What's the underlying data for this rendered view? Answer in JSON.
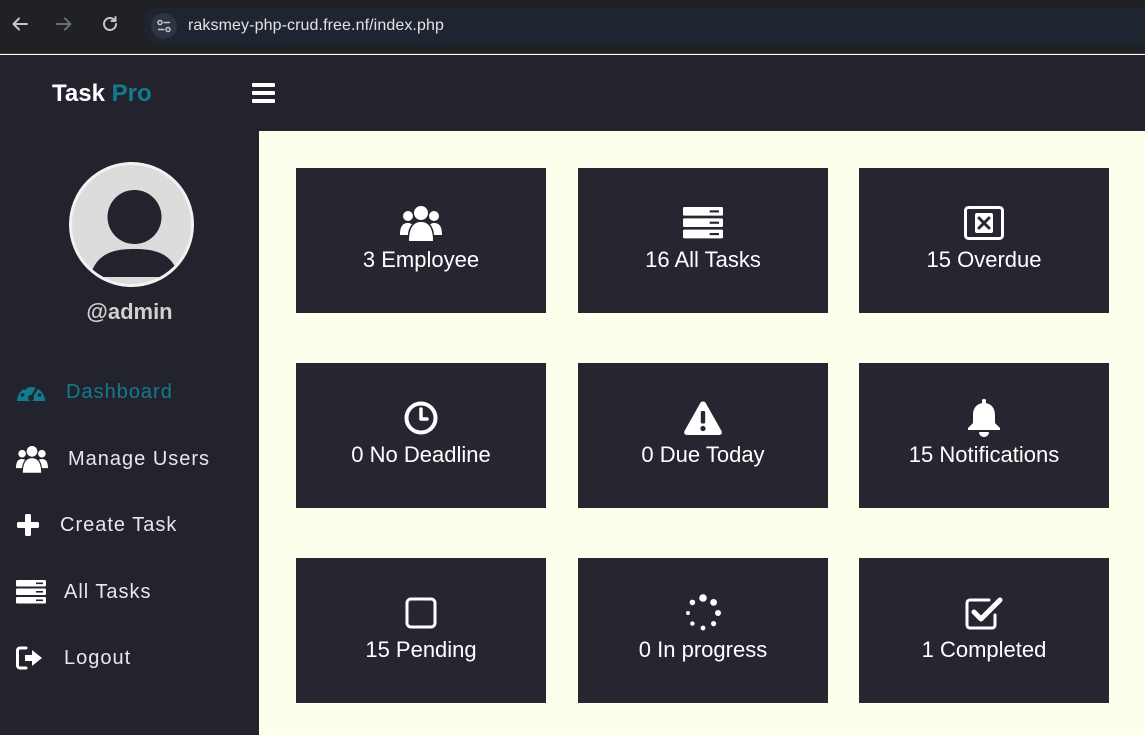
{
  "browser": {
    "url": "raksmey-php-crud.free.nf/index.php",
    "back_icon": "arrow-left-icon",
    "forward_icon": "arrow-right-icon",
    "reload_icon": "reload-icon",
    "site_info_icon": "site-settings-icon"
  },
  "header": {
    "brand_main": "Task",
    "brand_accent": "Pro",
    "menu_icon": "hamburger-menu-icon"
  },
  "sidebar": {
    "avatar_icon": "user-avatar-icon",
    "username": "@admin",
    "items": [
      {
        "label": "Dashboard",
        "icon": "dashboard-gauge-icon",
        "active": true
      },
      {
        "label": "Manage Users",
        "icon": "users-icon",
        "active": false
      },
      {
        "label": "Create Task",
        "icon": "plus-icon",
        "active": false
      },
      {
        "label": "All Tasks",
        "icon": "task-list-icon",
        "active": false
      },
      {
        "label": "Logout",
        "icon": "logout-icon",
        "active": false
      }
    ]
  },
  "cards": [
    {
      "text": "3 Employee",
      "icon": "users-icon"
    },
    {
      "text": "16 All Tasks",
      "icon": "task-list-icon"
    },
    {
      "text": "15 Overdue",
      "icon": "x-square-icon"
    },
    {
      "text": "0 No Deadline",
      "icon": "clock-icon"
    },
    {
      "text": "0 Due Today",
      "icon": "warning-icon"
    },
    {
      "text": "15 Notifications",
      "icon": "bell-icon"
    },
    {
      "text": "15 Pending",
      "icon": "square-icon"
    },
    {
      "text": "0 In progress",
      "icon": "spinner-icon"
    },
    {
      "text": "1 Completed",
      "icon": "check-square-icon"
    }
  ],
  "colors": {
    "accent": "#127b8e",
    "panel": "#23232d",
    "card": "#262631",
    "content_bg": "#fefeec"
  }
}
